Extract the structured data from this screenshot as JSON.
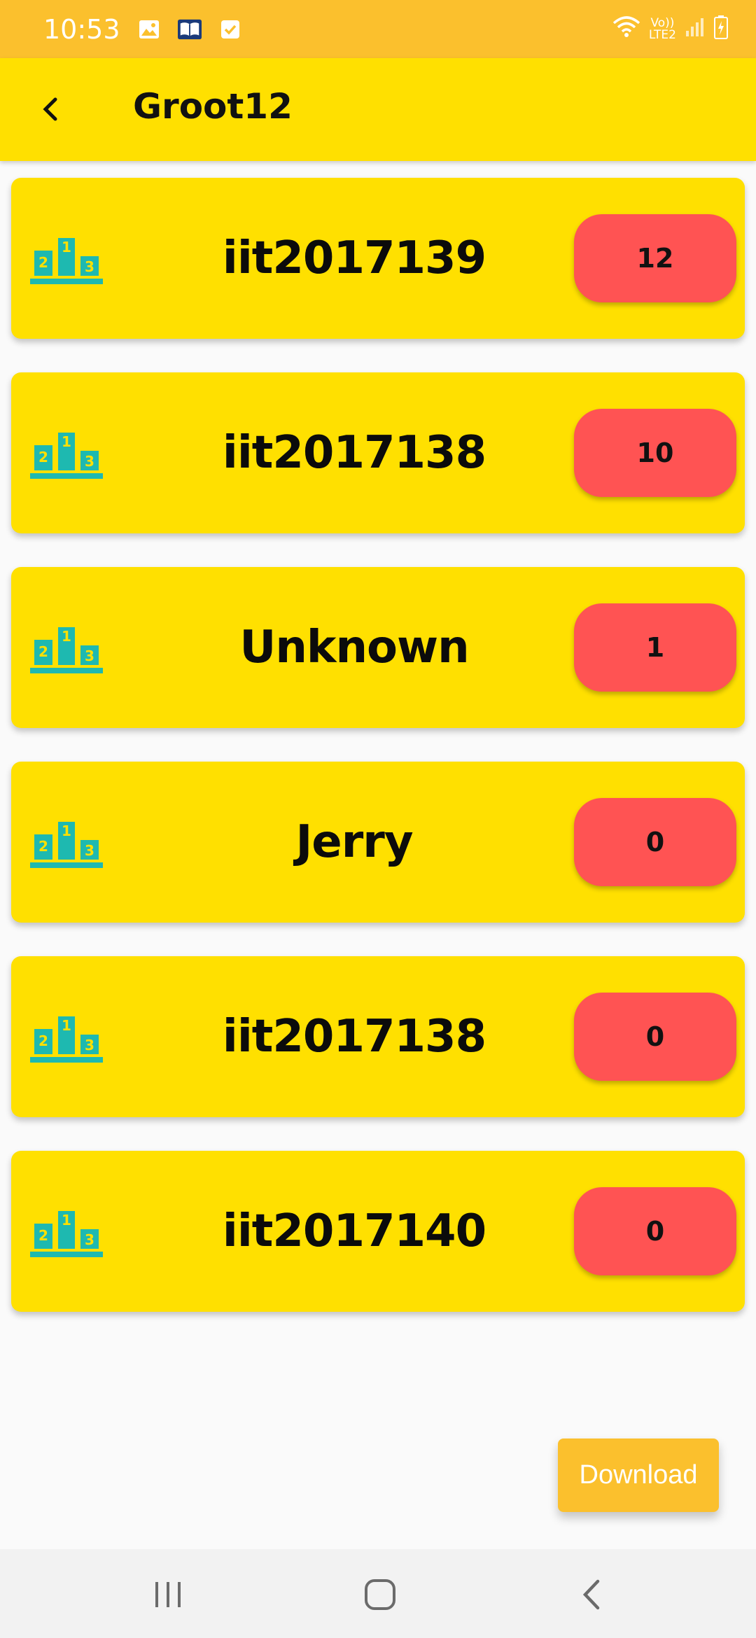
{
  "status_bar": {
    "time": "10:53",
    "icons": [
      "image-icon",
      "book-icon",
      "checkbox-icon"
    ],
    "network_top": "Vo))",
    "network_bottom": "LTE2",
    "right_icons": [
      "wifi-icon",
      "signal-icon",
      "battery-charging-icon"
    ]
  },
  "app_bar": {
    "title": "Groot12",
    "back_icon": "arrow-back-icon"
  },
  "leaderboard": [
    {
      "name": "iit2017139",
      "score": "12"
    },
    {
      "name": "iit2017138",
      "score": "10"
    },
    {
      "name": "Unknown",
      "score": "1"
    },
    {
      "name": "Jerry",
      "score": "0"
    },
    {
      "name": "iit2017138",
      "score": "0"
    },
    {
      "name": "iit2017140",
      "score": "0"
    }
  ],
  "podium_icon": {
    "labels": [
      "2",
      "1",
      "3"
    ],
    "color": "#1eb9b0"
  },
  "download_button": {
    "label": "Download"
  },
  "colors": {
    "status_bar": "#fbc02d",
    "app_bar": "#ffe000",
    "card": "#ffe000",
    "score_badge": "#ff5353",
    "button": "#fbc02d"
  },
  "nav_bar": {
    "buttons": [
      "recent-apps-icon",
      "home-icon",
      "back-icon"
    ]
  }
}
